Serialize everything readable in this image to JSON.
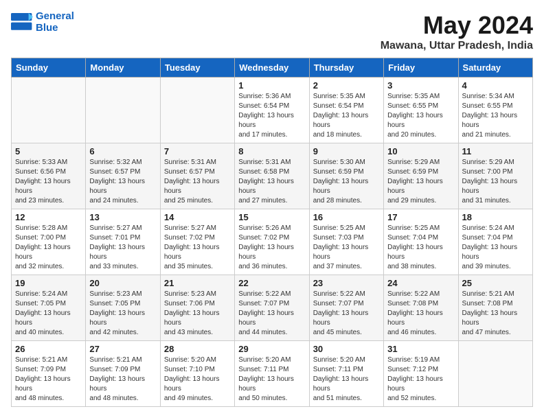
{
  "header": {
    "logo_line1": "General",
    "logo_line2": "Blue",
    "month_year": "May 2024",
    "location": "Mawana, Uttar Pradesh, India"
  },
  "days_of_week": [
    "Sunday",
    "Monday",
    "Tuesday",
    "Wednesday",
    "Thursday",
    "Friday",
    "Saturday"
  ],
  "weeks": [
    [
      {
        "day": "",
        "empty": true
      },
      {
        "day": "",
        "empty": true
      },
      {
        "day": "",
        "empty": true
      },
      {
        "day": "1",
        "sunrise": "5:36 AM",
        "sunset": "6:54 PM",
        "daylight": "13 hours and 17 minutes"
      },
      {
        "day": "2",
        "sunrise": "5:35 AM",
        "sunset": "6:54 PM",
        "daylight": "13 hours and 18 minutes"
      },
      {
        "day": "3",
        "sunrise": "5:35 AM",
        "sunset": "6:55 PM",
        "daylight": "13 hours and 20 minutes"
      },
      {
        "day": "4",
        "sunrise": "5:34 AM",
        "sunset": "6:55 PM",
        "daylight": "13 hours and 21 minutes"
      }
    ],
    [
      {
        "day": "5",
        "sunrise": "5:33 AM",
        "sunset": "6:56 PM",
        "daylight": "13 hours and 23 minutes"
      },
      {
        "day": "6",
        "sunrise": "5:32 AM",
        "sunset": "6:57 PM",
        "daylight": "13 hours and 24 minutes"
      },
      {
        "day": "7",
        "sunrise": "5:31 AM",
        "sunset": "6:57 PM",
        "daylight": "13 hours and 25 minutes"
      },
      {
        "day": "8",
        "sunrise": "5:31 AM",
        "sunset": "6:58 PM",
        "daylight": "13 hours and 27 minutes"
      },
      {
        "day": "9",
        "sunrise": "5:30 AM",
        "sunset": "6:59 PM",
        "daylight": "13 hours and 28 minutes"
      },
      {
        "day": "10",
        "sunrise": "5:29 AM",
        "sunset": "6:59 PM",
        "daylight": "13 hours and 29 minutes"
      },
      {
        "day": "11",
        "sunrise": "5:29 AM",
        "sunset": "7:00 PM",
        "daylight": "13 hours and 31 minutes"
      }
    ],
    [
      {
        "day": "12",
        "sunrise": "5:28 AM",
        "sunset": "7:00 PM",
        "daylight": "13 hours and 32 minutes"
      },
      {
        "day": "13",
        "sunrise": "5:27 AM",
        "sunset": "7:01 PM",
        "daylight": "13 hours and 33 minutes"
      },
      {
        "day": "14",
        "sunrise": "5:27 AM",
        "sunset": "7:02 PM",
        "daylight": "13 hours and 35 minutes"
      },
      {
        "day": "15",
        "sunrise": "5:26 AM",
        "sunset": "7:02 PM",
        "daylight": "13 hours and 36 minutes"
      },
      {
        "day": "16",
        "sunrise": "5:25 AM",
        "sunset": "7:03 PM",
        "daylight": "13 hours and 37 minutes"
      },
      {
        "day": "17",
        "sunrise": "5:25 AM",
        "sunset": "7:04 PM",
        "daylight": "13 hours and 38 minutes"
      },
      {
        "day": "18",
        "sunrise": "5:24 AM",
        "sunset": "7:04 PM",
        "daylight": "13 hours and 39 minutes"
      }
    ],
    [
      {
        "day": "19",
        "sunrise": "5:24 AM",
        "sunset": "7:05 PM",
        "daylight": "13 hours and 40 minutes"
      },
      {
        "day": "20",
        "sunrise": "5:23 AM",
        "sunset": "7:05 PM",
        "daylight": "13 hours and 42 minutes"
      },
      {
        "day": "21",
        "sunrise": "5:23 AM",
        "sunset": "7:06 PM",
        "daylight": "13 hours and 43 minutes"
      },
      {
        "day": "22",
        "sunrise": "5:22 AM",
        "sunset": "7:07 PM",
        "daylight": "13 hours and 44 minutes"
      },
      {
        "day": "23",
        "sunrise": "5:22 AM",
        "sunset": "7:07 PM",
        "daylight": "13 hours and 45 minutes"
      },
      {
        "day": "24",
        "sunrise": "5:22 AM",
        "sunset": "7:08 PM",
        "daylight": "13 hours and 46 minutes"
      },
      {
        "day": "25",
        "sunrise": "5:21 AM",
        "sunset": "7:08 PM",
        "daylight": "13 hours and 47 minutes"
      }
    ],
    [
      {
        "day": "26",
        "sunrise": "5:21 AM",
        "sunset": "7:09 PM",
        "daylight": "13 hours and 48 minutes"
      },
      {
        "day": "27",
        "sunrise": "5:21 AM",
        "sunset": "7:09 PM",
        "daylight": "13 hours and 48 minutes"
      },
      {
        "day": "28",
        "sunrise": "5:20 AM",
        "sunset": "7:10 PM",
        "daylight": "13 hours and 49 minutes"
      },
      {
        "day": "29",
        "sunrise": "5:20 AM",
        "sunset": "7:11 PM",
        "daylight": "13 hours and 50 minutes"
      },
      {
        "day": "30",
        "sunrise": "5:20 AM",
        "sunset": "7:11 PM",
        "daylight": "13 hours and 51 minutes"
      },
      {
        "day": "31",
        "sunrise": "5:19 AM",
        "sunset": "7:12 PM",
        "daylight": "13 hours and 52 minutes"
      },
      {
        "day": "",
        "empty": true
      }
    ]
  ]
}
